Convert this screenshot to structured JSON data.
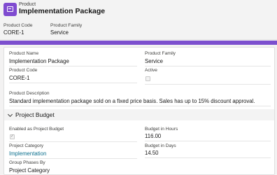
{
  "header": {
    "object_type": "Product",
    "title": "Implementation Package",
    "fields": [
      {
        "label": "Product Code",
        "value": "CORE-1"
      },
      {
        "label": "Product Family",
        "value": "Service"
      }
    ]
  },
  "details": {
    "product_name": {
      "label": "Product Name",
      "value": "Implementation Package"
    },
    "product_family": {
      "label": "Product Family",
      "value": "Service"
    },
    "product_code": {
      "label": "Product Code",
      "value": "CORE-1"
    },
    "active": {
      "label": "Active",
      "checked": false
    },
    "product_description": {
      "label": "Product Description",
      "value": "Standard implementation package sold on a fixed price basis. Sales has up to 15% discount approval."
    }
  },
  "project_budget": {
    "section_title": "Project Budget",
    "enabled": {
      "label": "Enabled as Project Budget",
      "checked": true
    },
    "budget_hours": {
      "label": "Budget in Hours",
      "value": "116.00"
    },
    "budget_days": {
      "label": "Budget in Days",
      "value": "14.50"
    },
    "project_category": {
      "label": "Project Category",
      "value": "Implementation"
    },
    "group_phases_by": {
      "label": "Group Phases By",
      "value": "Project Category"
    }
  },
  "colors": {
    "brand_purple": "#7c4fce",
    "link": "#0b6f8e"
  },
  "icons": {
    "object": "product-icon",
    "section_toggle": "chevron-down-icon",
    "checkmark": "checkmark-icon"
  }
}
